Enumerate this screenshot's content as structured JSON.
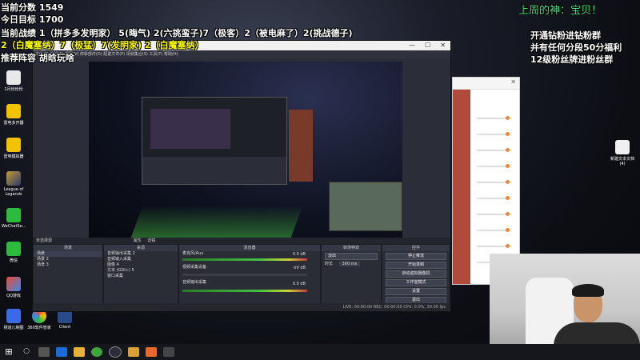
{
  "overlay": {
    "score_line": "当前分数 1549",
    "target_line": "今日目标 1700",
    "record_line1": "当前战绩 1（拼多多发明家） 5(晦气) 2(六挑蛮子)7（极客）2（被电麻了）2(挑战德子)",
    "record_line2": "2（白魔塞纳）7（极猛）7(发明家) 2（白魔塞纳）",
    "recommend_line": "推荐阵容 胡晗玩啥",
    "god_line": "上周的神：宝贝！",
    "group_line1": "开通钻粉进钻粉群",
    "group_line2": "并有任何分段50分福利",
    "group_line3": "12级粉丝牌进粉丝群"
  },
  "desktop_icons": [
    {
      "label": "1月份份份"
    },
    {
      "label": "雷电多开器"
    },
    {
      "label": "雷电模拟器"
    },
    {
      "label": "League of Legends"
    },
    {
      "label": "WeChatSe..."
    },
    {
      "label": "微信"
    },
    {
      "label": "QQ游戏"
    },
    {
      "label": "频道儿制图"
    },
    {
      "label": "360软件管家"
    },
    {
      "label": "Client"
    },
    {
      "label": "新建文本文档(4)"
    }
  ],
  "obs": {
    "menubar": "文件(F) 编辑(E) 视图(V) 停靠部件(D) 配置文件(P) 场景集合(S) 工具(T) 帮助(H)",
    "status_text": "未选择源",
    "props_btn": "属性",
    "filter_btn": "滤镜",
    "docks": {
      "scenes": {
        "title": "场景",
        "items": [
          "场景",
          "场景 2",
          "场景 3"
        ]
      },
      "sources": {
        "title": "来源",
        "items": [
          "音频输出采集 2",
          "音频输入采集",
          "图像 4",
          "文本 (GDI+) 5",
          "窗口采集"
        ]
      },
      "mixer": {
        "title": "混音器",
        "tracks": [
          {
            "name": "麦克风/Aux",
            "level": "0.0 dB"
          },
          {
            "name": "视频采集设备",
            "level": "-inf dB"
          },
          {
            "name": "音频输出采集",
            "level": "0.0 dB"
          }
        ]
      },
      "transitions": {
        "title": "转场特效",
        "mode": "淡出",
        "duration_label": "时长",
        "duration": "300 ms"
      },
      "controls": {
        "title": "控件",
        "buttons": [
          "停止推流",
          "开始录制",
          "启动虚拟摄像机",
          "工作室模式",
          "设置",
          "退出"
        ]
      }
    },
    "statusbar": "LIVE: 00:00:00    REC: 00:00:00    CPU: 0.0%, 30.00 fps"
  },
  "taskbar": {
    "time": "",
    "date": ""
  },
  "colors": {
    "overlay_yellow": "#ffff00",
    "overlay_green": "#3ee07a",
    "obs_bg": "#2b2e38"
  }
}
